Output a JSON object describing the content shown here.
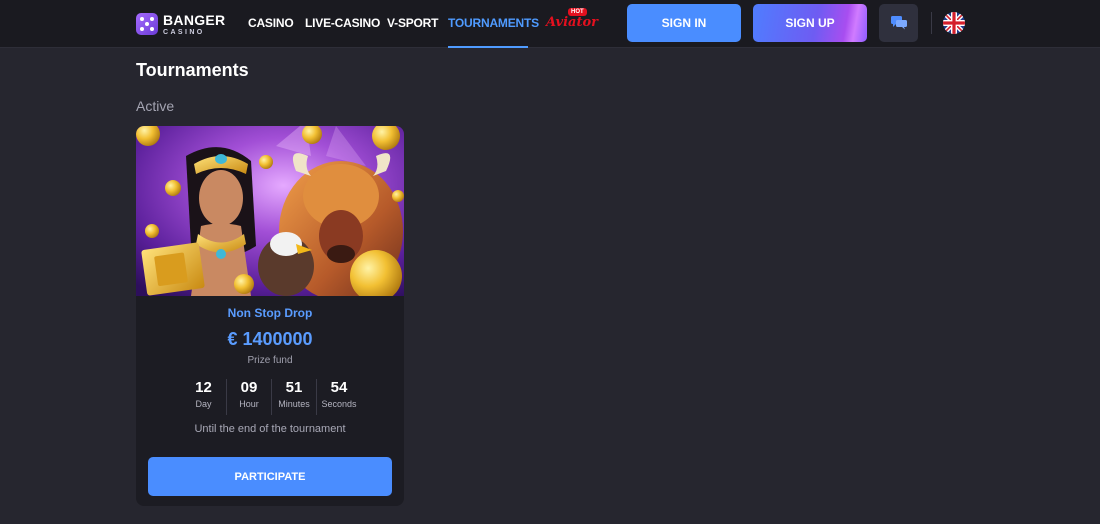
{
  "brand": {
    "name": "BANGER",
    "sub": "CASINO"
  },
  "nav": {
    "items": [
      {
        "label": "CASINO"
      },
      {
        "label": "LIVE-CASINO"
      },
      {
        "label": "V-SPORT"
      },
      {
        "label": "TOURNAMENTS",
        "active": true
      }
    ],
    "aviator": {
      "label": "Aviator",
      "badge": "HOT"
    }
  },
  "header": {
    "signin_label": "SIGN IN",
    "signup_label": "SIGN UP",
    "chat_icon": "chat-icon",
    "language_icon": "uk-flag-icon"
  },
  "page": {
    "title": "Tournaments",
    "section": "Active"
  },
  "tournament": {
    "name": "Non Stop Drop",
    "prize": "€ 1400000",
    "prize_label": "Prize fund",
    "timer": [
      {
        "value": "12",
        "unit": "Day"
      },
      {
        "value": "09",
        "unit": "Hour"
      },
      {
        "value": "51",
        "unit": "Minutes"
      },
      {
        "value": "54",
        "unit": "Seconds"
      }
    ],
    "until_text": "Until the end of the tournament",
    "button_label": "PARTICIPATE"
  },
  "colors": {
    "accent": "#4a8dff",
    "background": "#26262f",
    "header": "#1a1a20",
    "card": "#1c1c23",
    "aviator_red": "#e3101f"
  }
}
